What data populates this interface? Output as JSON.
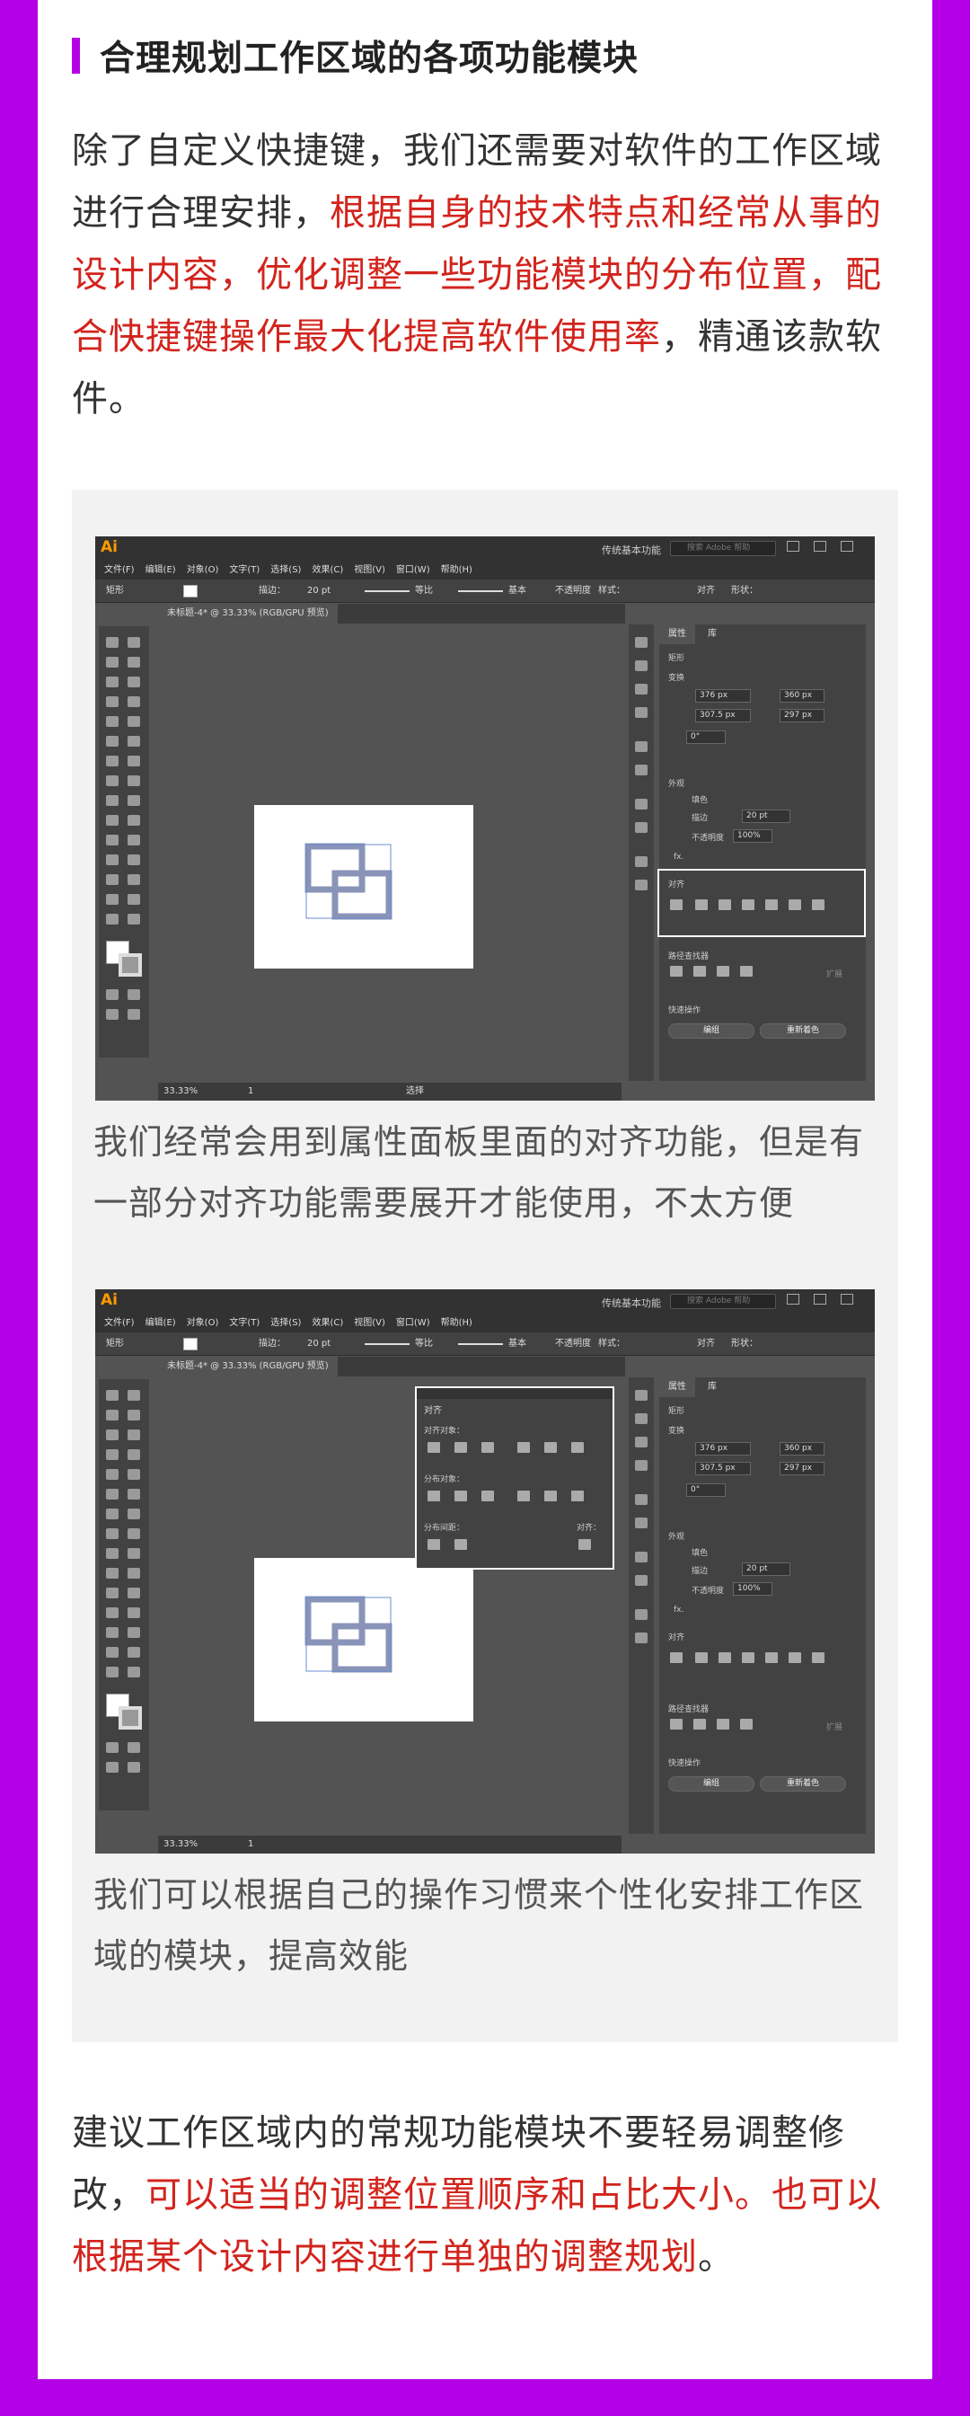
{
  "heading": "合理规划工作区域的各项功能模块",
  "intro": {
    "p1": "除了自定义快捷键，我们还需要对软件的工作区域进行合理安排，",
    "p1_red": "根据自身的技术特点和经常从事的设计内容，优化调整一些功能模块的分布位置，配合快捷键操作最大化提高软件使用率",
    "p1_end": "，精通该款软件。"
  },
  "screenshot1": {
    "logo": "Ai",
    "workspace": "传统基本功能",
    "search_placeholder": "搜索 Adobe 帮助",
    "menus": [
      "文件(F)",
      "编辑(E)",
      "对象(O)",
      "文字(T)",
      "选择(S)",
      "效果(C)",
      "视图(V)",
      "窗口(W)",
      "帮助(H)"
    ],
    "ctrl": {
      "shape": "矩形",
      "stroke": "描边：",
      "stroke_val": "20 pt",
      "uniform": "等比",
      "basic": "基本",
      "opacity": "不透明度",
      "style": "样式：",
      "align": "对齐",
      "shapes": "形状："
    },
    "tab": "未标题-4* @ 33.33% (RGB/GPU 预览)",
    "zoom": "33.33%",
    "page": "1",
    "select": "选择",
    "panel": {
      "tab_props": "属性",
      "tab_layers": "库",
      "rect": "矩形",
      "transform": "变换",
      "x": "376 px",
      "y": "307.5 px",
      "w": "360 px",
      "h": "297 px",
      "angle": "0°",
      "appearance": "外观",
      "fill": "填色",
      "stroke": "描边",
      "stroke_val": "20 pt",
      "opacity": "不透明度",
      "opacity_val": "100%",
      "fx": "fx.",
      "align": "对齐",
      "pathfinder": "路径查找器",
      "expand": "扩展",
      "quick": "快速操作",
      "edit": "编组",
      "recolor": "重新着色"
    }
  },
  "caption1": "我们经常会用到属性面板里面的对齐功能，但是有一部分对齐功能需要展开才能使用，不太方便",
  "screenshot2": {
    "float_title": "对齐",
    "align_objects": "对齐对象：",
    "distribute_objects": "分布对象：",
    "distribute_spacing": "分布间距：",
    "align_to": "对齐："
  },
  "caption2": "我们可以根据自己的操作习惯来个性化安排工作区域的模块，提高效能",
  "outro": {
    "p1": "建议工作区域内的常规功能模块不要轻易调整修改，",
    "p1_red": "可以适当的调整位置顺序和占比大小。也可以根据某个设计内容进行单独的调整规划",
    "p1_end": "。"
  }
}
